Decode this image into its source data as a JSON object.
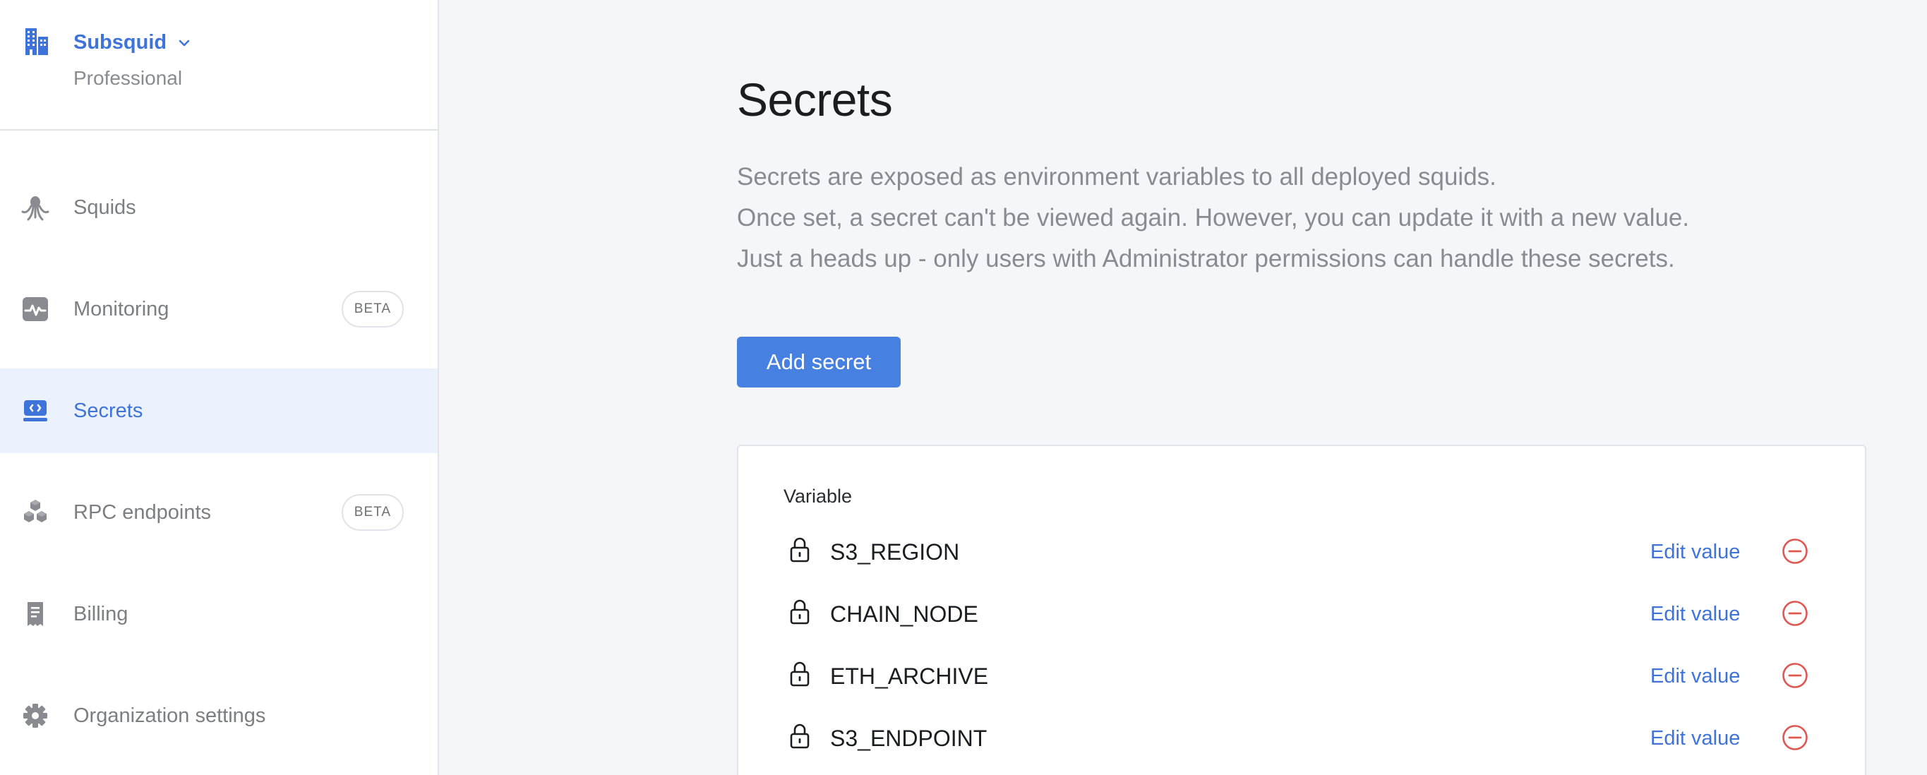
{
  "sidebar": {
    "org": {
      "name": "Subsquid",
      "plan": "Professional",
      "icon": "building-icon"
    },
    "items": [
      {
        "label": "Squids",
        "icon": "squid-icon",
        "active": false,
        "badge": ""
      },
      {
        "label": "Monitoring",
        "icon": "pulse-icon",
        "active": false,
        "badge": "BETA"
      },
      {
        "label": "Secrets",
        "icon": "secret-card-icon",
        "active": true,
        "badge": ""
      },
      {
        "label": "RPC endpoints",
        "icon": "cubes-icon",
        "active": false,
        "badge": "BETA"
      },
      {
        "label": "Billing",
        "icon": "receipt-icon",
        "active": false,
        "badge": ""
      },
      {
        "label": "Organization settings",
        "icon": "gear-icon",
        "active": false,
        "badge": ""
      }
    ]
  },
  "main": {
    "title": "Secrets",
    "description": [
      "Secrets are exposed as environment variables to all deployed squids.",
      "Once set, a secret can't be viewed again. However, you can update it with a new value.",
      "Just a heads up - only users with Administrator permissions can handle these secrets."
    ],
    "add_button": "Add secret",
    "table": {
      "header": "Variable",
      "edit_label": "Edit value",
      "rows": [
        {
          "name": "S3_REGION"
        },
        {
          "name": "CHAIN_NODE"
        },
        {
          "name": "ETH_ARCHIVE"
        },
        {
          "name": "S3_ENDPOINT"
        }
      ]
    }
  },
  "colors": {
    "accent": "#3e74da",
    "button": "#4681e2",
    "danger": "#e0574f",
    "active_bg": "#ebf2fd"
  }
}
